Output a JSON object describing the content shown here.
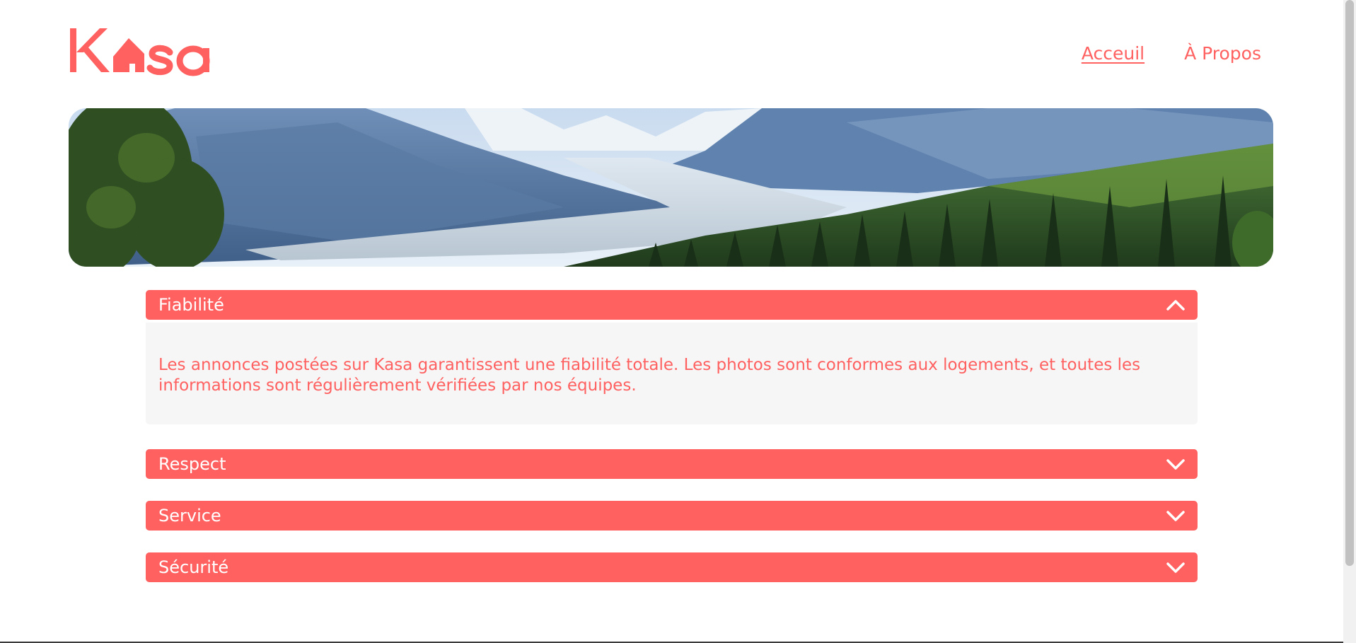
{
  "logo": {
    "text": "Kasa",
    "color": "#FF6060",
    "icon": "house-icon"
  },
  "nav": {
    "items": [
      {
        "label": "Acceuil",
        "active": true
      },
      {
        "label": "À Propos",
        "active": false
      }
    ]
  },
  "banner": {
    "image": "mountain-valley-landscape"
  },
  "collapses": [
    {
      "title": "Fiabilité",
      "open": true,
      "content": "Les annonces postées sur Kasa garantissent une fiabilité totale. Les photos sont conformes aux logements, et toutes les informations sont régulièrement vérifiées par nos équipes."
    },
    {
      "title": "Respect",
      "open": false
    },
    {
      "title": "Service",
      "open": false
    },
    {
      "title": "Sécurité",
      "open": false
    }
  ],
  "colors": {
    "primary": "#FF6060",
    "panel": "#F6F6F6",
    "white": "#FFFFFF"
  }
}
